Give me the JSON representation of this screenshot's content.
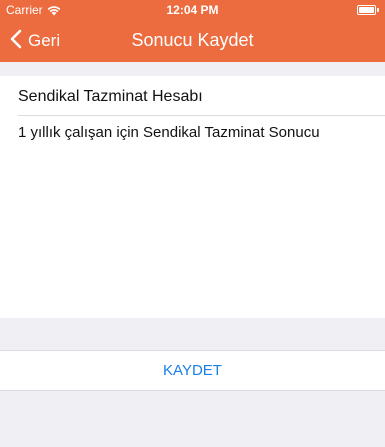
{
  "status_bar": {
    "carrier": "Carrier",
    "time": "12:04 PM",
    "wifi_icon": "wifi-icon",
    "battery_icon": "battery-icon"
  },
  "nav": {
    "back_label": "Geri",
    "back_icon": "chevron-left-icon",
    "title": "Sonucu Kaydet"
  },
  "content": {
    "title": "Sendikal Tazminat Hesabı",
    "body": "1 yıllık çalışan için Sendikal Tazminat Sonucu"
  },
  "actions": {
    "save_label": "KAYDET"
  },
  "colors": {
    "header": "#ec6b3f",
    "background": "#efeff4",
    "action": "#1a7fe8"
  }
}
